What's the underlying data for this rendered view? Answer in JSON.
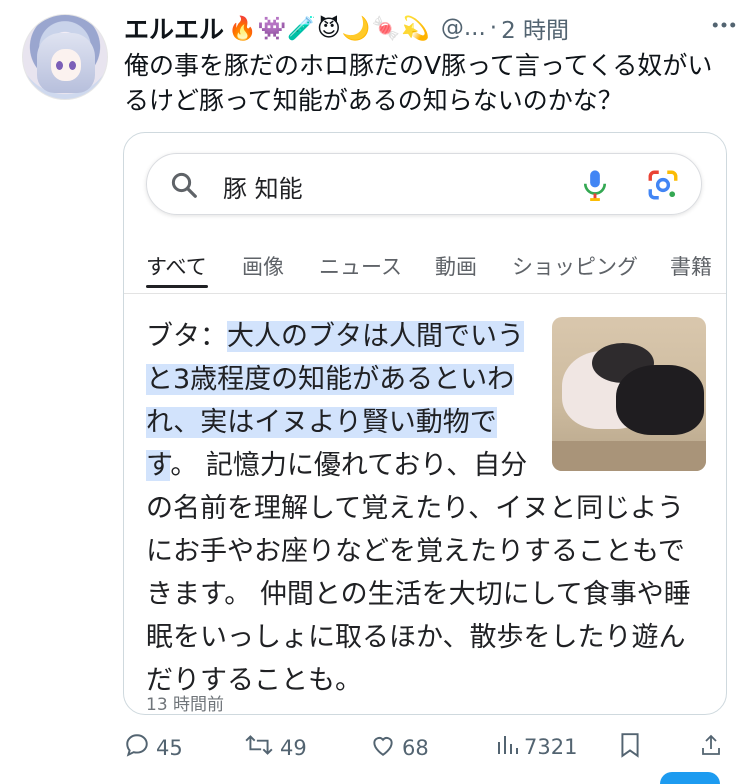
{
  "tweet": {
    "display_name": "エルエル",
    "name_emojis": "🔥👾🧪😈🌙🍬💫",
    "handle": "@...",
    "separator": "·",
    "time": "2 時間",
    "text": "俺の事を豚だのホロ豚だのV豚って言ってくる奴がいるけど豚って知能があるの知らないのかな？"
  },
  "search": {
    "query": "豚 知能",
    "tabs": [
      "すべて",
      "画像",
      "ニュース",
      "動画",
      "ショッピング",
      "書籍"
    ],
    "active_tab": "すべて",
    "snippet_label": "ブタ：",
    "snippet_highlight": "大人のブタは人間でいうと3歳程度の知能があるといわれ、実はイヌより賢い動物です",
    "snippet_rest": "。 記憶力に優れており、自分の名前を理解して覚えたり、イヌと同じようにお手やお座りなどを覚えたりすることもできます。 仲間との生活を大切にして食事や睡眠をいっしょに取るほか、散歩をしたり遊んだりすることも。",
    "result_time": "13 時間前"
  },
  "actions": {
    "replies": "45",
    "retweets": "49",
    "likes": "68",
    "views": "7321"
  },
  "colors": {
    "highlight": "#d2e3fc",
    "muted": "#536471",
    "accent": "#1d9bf0"
  },
  "icons": [
    "more-icon",
    "search-icon",
    "mic-icon",
    "lens-icon",
    "reply-icon",
    "retweet-icon",
    "like-icon",
    "views-icon",
    "bookmark-icon",
    "share-icon"
  ]
}
